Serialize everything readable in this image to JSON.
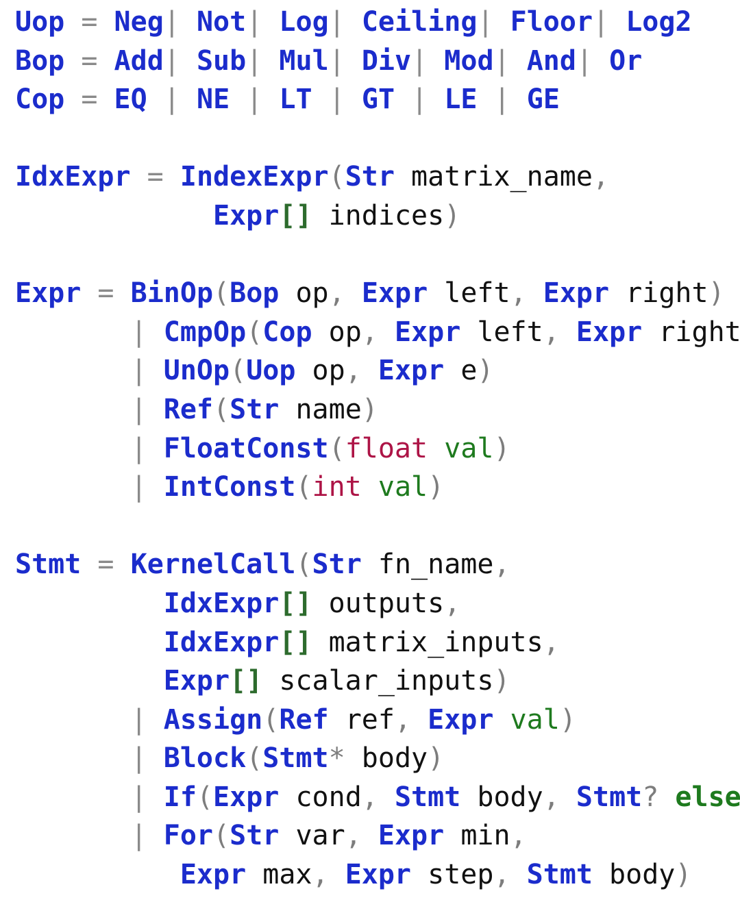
{
  "document": {
    "kind": "asdl-grammar",
    "background_color": "#ffffff",
    "colors": {
      "type": "#1b2ccc",
      "constructor": "#1b2ccc",
      "primitive": "#ad1446",
      "field": "#111111",
      "field_green": "#1e7a1e",
      "keyword": "#1e7a1e",
      "bracket": "#2d6b2d",
      "punct": "#7d7d7d",
      "bar": "#8a8a8a"
    }
  },
  "lines": [
    {
      "id": "uop-rule",
      "tokens": [
        {
          "t": "Uop",
          "c": "type"
        },
        {
          "t": " ",
          "c": "space"
        },
        {
          "t": "=",
          "c": "eq"
        },
        {
          "t": " ",
          "c": "space"
        },
        {
          "t": "Neg",
          "c": "ctor"
        },
        {
          "t": "|",
          "c": "bar"
        },
        {
          "t": " ",
          "c": "space"
        },
        {
          "t": "Not",
          "c": "ctor"
        },
        {
          "t": "|",
          "c": "bar"
        },
        {
          "t": " ",
          "c": "space"
        },
        {
          "t": "Log",
          "c": "ctor"
        },
        {
          "t": "|",
          "c": "bar"
        },
        {
          "t": " ",
          "c": "space"
        },
        {
          "t": "Ceiling",
          "c": "ctor"
        },
        {
          "t": "|",
          "c": "bar"
        },
        {
          "t": " ",
          "c": "space"
        },
        {
          "t": "Floor",
          "c": "ctor"
        },
        {
          "t": "|",
          "c": "bar"
        },
        {
          "t": " ",
          "c": "space"
        },
        {
          "t": "Log2",
          "c": "ctor"
        }
      ]
    },
    {
      "id": "bop-rule",
      "tokens": [
        {
          "t": "Bop",
          "c": "type"
        },
        {
          "t": " ",
          "c": "space"
        },
        {
          "t": "=",
          "c": "eq"
        },
        {
          "t": " ",
          "c": "space"
        },
        {
          "t": "Add",
          "c": "ctor"
        },
        {
          "t": "|",
          "c": "bar"
        },
        {
          "t": " ",
          "c": "space"
        },
        {
          "t": "Sub",
          "c": "ctor"
        },
        {
          "t": "|",
          "c": "bar"
        },
        {
          "t": " ",
          "c": "space"
        },
        {
          "t": "Mul",
          "c": "ctor"
        },
        {
          "t": "|",
          "c": "bar"
        },
        {
          "t": " ",
          "c": "space"
        },
        {
          "t": "Div",
          "c": "ctor"
        },
        {
          "t": "|",
          "c": "bar"
        },
        {
          "t": " ",
          "c": "space"
        },
        {
          "t": "Mod",
          "c": "ctor"
        },
        {
          "t": "|",
          "c": "bar"
        },
        {
          "t": " ",
          "c": "space"
        },
        {
          "t": "And",
          "c": "ctor"
        },
        {
          "t": "|",
          "c": "bar"
        },
        {
          "t": " ",
          "c": "space"
        },
        {
          "t": "Or",
          "c": "ctor"
        }
      ]
    },
    {
      "id": "cop-rule",
      "tokens": [
        {
          "t": "Cop",
          "c": "type"
        },
        {
          "t": " ",
          "c": "space"
        },
        {
          "t": "=",
          "c": "eq"
        },
        {
          "t": " ",
          "c": "space"
        },
        {
          "t": "EQ",
          "c": "ctor"
        },
        {
          "t": " ",
          "c": "space"
        },
        {
          "t": "|",
          "c": "bar"
        },
        {
          "t": " ",
          "c": "space"
        },
        {
          "t": "NE",
          "c": "ctor"
        },
        {
          "t": " ",
          "c": "space"
        },
        {
          "t": "|",
          "c": "bar"
        },
        {
          "t": " ",
          "c": "space"
        },
        {
          "t": "LT",
          "c": "ctor"
        },
        {
          "t": " ",
          "c": "space"
        },
        {
          "t": "|",
          "c": "bar"
        },
        {
          "t": " ",
          "c": "space"
        },
        {
          "t": "GT",
          "c": "ctor"
        },
        {
          "t": " ",
          "c": "space"
        },
        {
          "t": "|",
          "c": "bar"
        },
        {
          "t": " ",
          "c": "space"
        },
        {
          "t": "LE",
          "c": "ctor"
        },
        {
          "t": " ",
          "c": "space"
        },
        {
          "t": "|",
          "c": "bar"
        },
        {
          "t": " ",
          "c": "space"
        },
        {
          "t": "GE",
          "c": "ctor"
        }
      ]
    },
    {
      "id": "blank-1",
      "tokens": []
    },
    {
      "id": "idxexpr-rule",
      "tokens": [
        {
          "t": "IdxExpr",
          "c": "type"
        },
        {
          "t": " ",
          "c": "space"
        },
        {
          "t": "=",
          "c": "eq"
        },
        {
          "t": " ",
          "c": "space"
        },
        {
          "t": "IndexExpr",
          "c": "ctor"
        },
        {
          "t": "(",
          "c": "punct"
        },
        {
          "t": "Str",
          "c": "type"
        },
        {
          "t": " ",
          "c": "space"
        },
        {
          "t": "matrix_name",
          "c": "field"
        },
        {
          "t": ",",
          "c": "punct"
        }
      ]
    },
    {
      "id": "idxexpr-rule-cont",
      "tokens": [
        {
          "t": "            ",
          "c": "space"
        },
        {
          "t": "Expr",
          "c": "type"
        },
        {
          "t": "[]",
          "c": "brack"
        },
        {
          "t": " ",
          "c": "space"
        },
        {
          "t": "indices",
          "c": "field"
        },
        {
          "t": ")",
          "c": "punct"
        }
      ]
    },
    {
      "id": "blank-2",
      "tokens": []
    },
    {
      "id": "expr-rule-binop",
      "tokens": [
        {
          "t": "Expr",
          "c": "type"
        },
        {
          "t": " ",
          "c": "space"
        },
        {
          "t": "=",
          "c": "eq"
        },
        {
          "t": " ",
          "c": "space"
        },
        {
          "t": "BinOp",
          "c": "ctor"
        },
        {
          "t": "(",
          "c": "punct"
        },
        {
          "t": "Bop",
          "c": "type"
        },
        {
          "t": " ",
          "c": "space"
        },
        {
          "t": "op",
          "c": "field"
        },
        {
          "t": ",",
          "c": "punct"
        },
        {
          "t": " ",
          "c": "space"
        },
        {
          "t": "Expr",
          "c": "type"
        },
        {
          "t": " ",
          "c": "space"
        },
        {
          "t": "left",
          "c": "field"
        },
        {
          "t": ",",
          "c": "punct"
        },
        {
          "t": " ",
          "c": "space"
        },
        {
          "t": "Expr",
          "c": "type"
        },
        {
          "t": " ",
          "c": "space"
        },
        {
          "t": "right",
          "c": "field"
        },
        {
          "t": ")",
          "c": "punct"
        }
      ]
    },
    {
      "id": "expr-rule-cmpop",
      "tokens": [
        {
          "t": "       ",
          "c": "space"
        },
        {
          "t": "|",
          "c": "bar"
        },
        {
          "t": " ",
          "c": "space"
        },
        {
          "t": "CmpOp",
          "c": "ctor"
        },
        {
          "t": "(",
          "c": "punct"
        },
        {
          "t": "Cop",
          "c": "type"
        },
        {
          "t": " ",
          "c": "space"
        },
        {
          "t": "op",
          "c": "field"
        },
        {
          "t": ",",
          "c": "punct"
        },
        {
          "t": " ",
          "c": "space"
        },
        {
          "t": "Expr",
          "c": "type"
        },
        {
          "t": " ",
          "c": "space"
        },
        {
          "t": "left",
          "c": "field"
        },
        {
          "t": ",",
          "c": "punct"
        },
        {
          "t": " ",
          "c": "space"
        },
        {
          "t": "Expr",
          "c": "type"
        },
        {
          "t": " ",
          "c": "space"
        },
        {
          "t": "right",
          "c": "field"
        },
        {
          "t": ")",
          "c": "punct"
        }
      ]
    },
    {
      "id": "expr-rule-unop",
      "tokens": [
        {
          "t": "       ",
          "c": "space"
        },
        {
          "t": "|",
          "c": "bar"
        },
        {
          "t": " ",
          "c": "space"
        },
        {
          "t": "UnOp",
          "c": "ctor"
        },
        {
          "t": "(",
          "c": "punct"
        },
        {
          "t": "Uop",
          "c": "type"
        },
        {
          "t": " ",
          "c": "space"
        },
        {
          "t": "op",
          "c": "field"
        },
        {
          "t": ",",
          "c": "punct"
        },
        {
          "t": " ",
          "c": "space"
        },
        {
          "t": "Expr",
          "c": "type"
        },
        {
          "t": " ",
          "c": "space"
        },
        {
          "t": "e",
          "c": "field"
        },
        {
          "t": ")",
          "c": "punct"
        }
      ]
    },
    {
      "id": "expr-rule-ref",
      "tokens": [
        {
          "t": "       ",
          "c": "space"
        },
        {
          "t": "|",
          "c": "bar"
        },
        {
          "t": " ",
          "c": "space"
        },
        {
          "t": "Ref",
          "c": "ctor"
        },
        {
          "t": "(",
          "c": "punct"
        },
        {
          "t": "Str",
          "c": "type"
        },
        {
          "t": " ",
          "c": "space"
        },
        {
          "t": "name",
          "c": "field"
        },
        {
          "t": ")",
          "c": "punct"
        }
      ]
    },
    {
      "id": "expr-rule-floatconst",
      "tokens": [
        {
          "t": "       ",
          "c": "space"
        },
        {
          "t": "|",
          "c": "bar"
        },
        {
          "t": " ",
          "c": "space"
        },
        {
          "t": "FloatConst",
          "c": "ctor"
        },
        {
          "t": "(",
          "c": "punct"
        },
        {
          "t": "float",
          "c": "prim"
        },
        {
          "t": " ",
          "c": "space"
        },
        {
          "t": "val",
          "c": "fieldg"
        },
        {
          "t": ")",
          "c": "punct"
        }
      ]
    },
    {
      "id": "expr-rule-intconst",
      "tokens": [
        {
          "t": "       ",
          "c": "space"
        },
        {
          "t": "|",
          "c": "bar"
        },
        {
          "t": " ",
          "c": "space"
        },
        {
          "t": "IntConst",
          "c": "ctor"
        },
        {
          "t": "(",
          "c": "punct"
        },
        {
          "t": "int",
          "c": "prim"
        },
        {
          "t": " ",
          "c": "space"
        },
        {
          "t": "val",
          "c": "fieldg"
        },
        {
          "t": ")",
          "c": "punct"
        }
      ]
    },
    {
      "id": "blank-3",
      "tokens": []
    },
    {
      "id": "stmt-rule-kernelcall",
      "tokens": [
        {
          "t": "Stmt",
          "c": "type"
        },
        {
          "t": " ",
          "c": "space"
        },
        {
          "t": "=",
          "c": "eq"
        },
        {
          "t": " ",
          "c": "space"
        },
        {
          "t": "KernelCall",
          "c": "ctor"
        },
        {
          "t": "(",
          "c": "punct"
        },
        {
          "t": "Str",
          "c": "type"
        },
        {
          "t": " ",
          "c": "space"
        },
        {
          "t": "fn_name",
          "c": "field"
        },
        {
          "t": ",",
          "c": "punct"
        }
      ]
    },
    {
      "id": "stmt-rule-outputs",
      "tokens": [
        {
          "t": "         ",
          "c": "space"
        },
        {
          "t": "IdxExpr",
          "c": "type"
        },
        {
          "t": "[]",
          "c": "brack"
        },
        {
          "t": " ",
          "c": "space"
        },
        {
          "t": "outputs",
          "c": "field"
        },
        {
          "t": ",",
          "c": "punct"
        }
      ]
    },
    {
      "id": "stmt-rule-matrix-inputs",
      "tokens": [
        {
          "t": "         ",
          "c": "space"
        },
        {
          "t": "IdxExpr",
          "c": "type"
        },
        {
          "t": "[]",
          "c": "brack"
        },
        {
          "t": " ",
          "c": "space"
        },
        {
          "t": "matrix_inputs",
          "c": "field"
        },
        {
          "t": ",",
          "c": "punct"
        }
      ]
    },
    {
      "id": "stmt-rule-scalar-inputs",
      "tokens": [
        {
          "t": "         ",
          "c": "space"
        },
        {
          "t": "Expr",
          "c": "type"
        },
        {
          "t": "[]",
          "c": "brack"
        },
        {
          "t": " ",
          "c": "space"
        },
        {
          "t": "scalar_inputs",
          "c": "field"
        },
        {
          "t": ")",
          "c": "punct"
        }
      ]
    },
    {
      "id": "stmt-rule-assign",
      "tokens": [
        {
          "t": "       ",
          "c": "space"
        },
        {
          "t": "|",
          "c": "bar"
        },
        {
          "t": " ",
          "c": "space"
        },
        {
          "t": "Assign",
          "c": "ctor"
        },
        {
          "t": "(",
          "c": "punct"
        },
        {
          "t": "Ref",
          "c": "type"
        },
        {
          "t": " ",
          "c": "space"
        },
        {
          "t": "ref",
          "c": "field"
        },
        {
          "t": ",",
          "c": "punct"
        },
        {
          "t": " ",
          "c": "space"
        },
        {
          "t": "Expr",
          "c": "type"
        },
        {
          "t": " ",
          "c": "space"
        },
        {
          "t": "val",
          "c": "fieldg"
        },
        {
          "t": ")",
          "c": "punct"
        }
      ]
    },
    {
      "id": "stmt-rule-block",
      "tokens": [
        {
          "t": "       ",
          "c": "space"
        },
        {
          "t": "|",
          "c": "bar"
        },
        {
          "t": " ",
          "c": "space"
        },
        {
          "t": "Block",
          "c": "ctor"
        },
        {
          "t": "(",
          "c": "punct"
        },
        {
          "t": "Stmt",
          "c": "type"
        },
        {
          "t": "*",
          "c": "punct"
        },
        {
          "t": " ",
          "c": "space"
        },
        {
          "t": "body",
          "c": "field"
        },
        {
          "t": ")",
          "c": "punct"
        }
      ]
    },
    {
      "id": "stmt-rule-if",
      "tokens": [
        {
          "t": "       ",
          "c": "space"
        },
        {
          "t": "|",
          "c": "bar"
        },
        {
          "t": " ",
          "c": "space"
        },
        {
          "t": "If",
          "c": "ctor"
        },
        {
          "t": "(",
          "c": "punct"
        },
        {
          "t": "Expr",
          "c": "type"
        },
        {
          "t": " ",
          "c": "space"
        },
        {
          "t": "cond",
          "c": "field"
        },
        {
          "t": ",",
          "c": "punct"
        },
        {
          "t": " ",
          "c": "space"
        },
        {
          "t": "Stmt",
          "c": "type"
        },
        {
          "t": " ",
          "c": "space"
        },
        {
          "t": "body",
          "c": "field"
        },
        {
          "t": ",",
          "c": "punct"
        },
        {
          "t": " ",
          "c": "space"
        },
        {
          "t": "Stmt",
          "c": "type"
        },
        {
          "t": "?",
          "c": "punct"
        },
        {
          "t": " ",
          "c": "space"
        },
        {
          "t": "else",
          "c": "kw"
        },
        {
          "t": ")",
          "c": "punct"
        }
      ]
    },
    {
      "id": "stmt-rule-for",
      "tokens": [
        {
          "t": "       ",
          "c": "space"
        },
        {
          "t": "|",
          "c": "bar"
        },
        {
          "t": " ",
          "c": "space"
        },
        {
          "t": "For",
          "c": "ctor"
        },
        {
          "t": "(",
          "c": "punct"
        },
        {
          "t": "Str",
          "c": "type"
        },
        {
          "t": " ",
          "c": "space"
        },
        {
          "t": "var",
          "c": "field"
        },
        {
          "t": ",",
          "c": "punct"
        },
        {
          "t": " ",
          "c": "space"
        },
        {
          "t": "Expr",
          "c": "type"
        },
        {
          "t": " ",
          "c": "space"
        },
        {
          "t": "min",
          "c": "field"
        },
        {
          "t": ",",
          "c": "punct"
        }
      ]
    },
    {
      "id": "stmt-rule-for-cont",
      "tokens": [
        {
          "t": "          ",
          "c": "space"
        },
        {
          "t": "Expr",
          "c": "type"
        },
        {
          "t": " ",
          "c": "space"
        },
        {
          "t": "max",
          "c": "field"
        },
        {
          "t": ",",
          "c": "punct"
        },
        {
          "t": " ",
          "c": "space"
        },
        {
          "t": "Expr",
          "c": "type"
        },
        {
          "t": " ",
          "c": "space"
        },
        {
          "t": "step",
          "c": "field"
        },
        {
          "t": ",",
          "c": "punct"
        },
        {
          "t": " ",
          "c": "space"
        },
        {
          "t": "Stmt",
          "c": "type"
        },
        {
          "t": " ",
          "c": "space"
        },
        {
          "t": "body",
          "c": "field"
        },
        {
          "t": ")",
          "c": "punct"
        }
      ]
    }
  ]
}
